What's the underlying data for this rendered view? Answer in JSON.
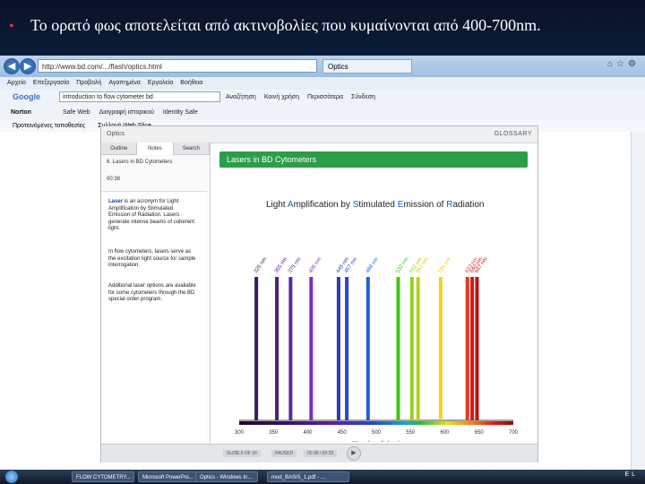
{
  "slide": {
    "bullet": "•",
    "title": "Το ορατό φως αποτελείται από ακτινοβολίες που κυμαίνονται από 400-700nm."
  },
  "browser": {
    "address": "http://www.bd.com/.../flash/optics.html",
    "tab_label": "Optics",
    "menu": [
      "Αρχείο",
      "Επεξεργασία",
      "Προβολή",
      "Αγαπημένα",
      "Εργαλεία",
      "Βοήθεια"
    ],
    "google_label": "Google",
    "google_query": "introduction to flow cytometer bd",
    "toolbar_items": [
      "Αναζήτηση",
      "Κοινή χρήση",
      "Περισσότερα",
      "Σύνδεση"
    ],
    "norton_label": "Norton",
    "norton_items": [
      "Safe Web",
      "Διαγραφή ιστορικού",
      "Identity Safe"
    ],
    "bookmarks": [
      "Προτεινόμενες τοποθεσίες",
      "Συλλογή Web Slice"
    ]
  },
  "app": {
    "header_title": "Optics",
    "glossary": "GLOSSARY",
    "side_tabs": [
      "Outline",
      "Notes",
      "Search"
    ],
    "lesson_title": "6. Lasers in BD Cytometers",
    "timer": "00:38",
    "paragraphs": [
      {
        "lead": "Laser",
        "text": " is an acronym for Light Amplification by Stimulated Emission of Radiation. Lasers generate intense beams of coherent light."
      },
      {
        "lead": "",
        "text": "In flow cytometers, lasers serve as the excitation light source for sample interrogation."
      },
      {
        "lead": "",
        "text": "Additional laser options are available for some cytometers through the BD special order program."
      }
    ],
    "banner": "Lasers in BD Cytometers",
    "chart_title_parts": [
      {
        "t": "Light ",
        "hl": false
      },
      {
        "t": "A",
        "hl": true
      },
      {
        "t": "mplification by ",
        "hl": false
      },
      {
        "t": "S",
        "hl": true
      },
      {
        "t": "timulated ",
        "hl": false
      },
      {
        "t": "E",
        "hl": true
      },
      {
        "t": "mission of ",
        "hl": false
      },
      {
        "t": "R",
        "hl": true
      },
      {
        "t": "adiation",
        "hl": false
      }
    ],
    "bottom_items": [
      "SLIDE 6 OF 16",
      "PAUSED",
      "00:38 / 00:28"
    ]
  },
  "chart_data": {
    "type": "bar",
    "xlabel": "Wavelength (nm)",
    "xlim": [
      300,
      700
    ],
    "ticks": [
      300,
      350,
      400,
      450,
      500,
      550,
      600,
      650,
      700
    ],
    "lines": [
      {
        "nm": 325,
        "label": "325 nm",
        "color": "#3a1a5e"
      },
      {
        "nm": 355,
        "label": "355 nm",
        "color": "#4a2080"
      },
      {
        "nm": 375,
        "label": "375 nm",
        "color": "#5a2aa0"
      },
      {
        "nm": 405,
        "label": "405 nm",
        "color": "#7a2ec4"
      },
      {
        "nm": 445,
        "label": "445 nm",
        "color": "#2f3bb0"
      },
      {
        "nm": 457,
        "label": "457 nm",
        "color": "#2c46c2"
      },
      {
        "nm": 488,
        "label": "488 nm",
        "color": "#1f5ee6"
      },
      {
        "nm": 532,
        "label": "532 nm",
        "color": "#44c21c"
      },
      {
        "nm": 552,
        "label": "552 nm",
        "color": "#8ed41a"
      },
      {
        "nm": 561,
        "label": "561 nm",
        "color": "#b6d41a"
      },
      {
        "nm": 594,
        "label": "594 nm",
        "color": "#f0d21a"
      },
      {
        "nm": 633,
        "label": "633 nm",
        "color": "#e03a1c"
      },
      {
        "nm": 640,
        "label": "640 nm",
        "color": "#d11a1a"
      },
      {
        "nm": 647,
        "label": "647 nm",
        "color": "#c01010"
      }
    ]
  },
  "taskbar": {
    "tasks": [
      "FLOW CYTOMETRY...",
      "Microsoft PowerPoi...",
      "Optics - Windows In...",
      "mod_BASIS_1.pdf - ..."
    ],
    "tray": "EL"
  },
  "colors": {
    "banner": "#2d9d48",
    "slide_bg": "#0a1a33",
    "highlight": "#1f5fb8"
  }
}
